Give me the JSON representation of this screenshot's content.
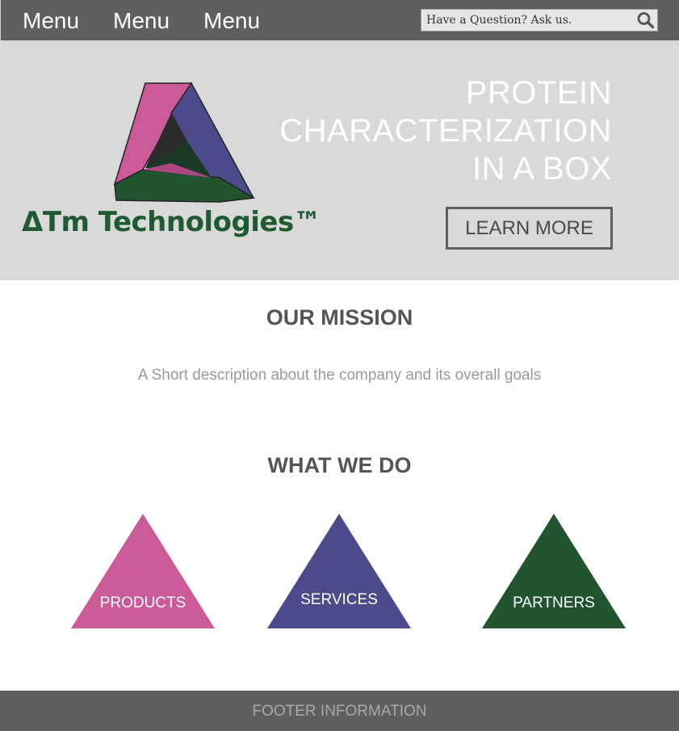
{
  "nav": {
    "menu_items": [
      "Menu",
      "Menu",
      "Menu"
    ],
    "search_placeholder": "Have a Question? Ask us."
  },
  "hero": {
    "logo_text": "ΔTm Technologies™",
    "title_lines": [
      "PROTEIN",
      "CHARACTERIZATION",
      "IN A BOX"
    ],
    "cta_label": "LEARN MORE"
  },
  "mission": {
    "title": "OUR MISSION",
    "description": "A Short description about the company and its overall goals"
  },
  "what_we_do": {
    "title": "WHAT WE DO",
    "items": [
      {
        "label": "PRODUCTS",
        "color": "#cc5a99"
      },
      {
        "label": "SERVICES",
        "color": "#4b4b8c"
      },
      {
        "label": "PARTNERS",
        "color": "#215530"
      }
    ]
  },
  "footer": {
    "text": "FOOTER INFORMATION"
  },
  "colors": {
    "nav_bg": "#5f5f5f",
    "hero_bg": "#d9d9d9",
    "logo_pink": "#cc5a99",
    "logo_blue": "#4b4b8c",
    "logo_green": "#215530"
  }
}
